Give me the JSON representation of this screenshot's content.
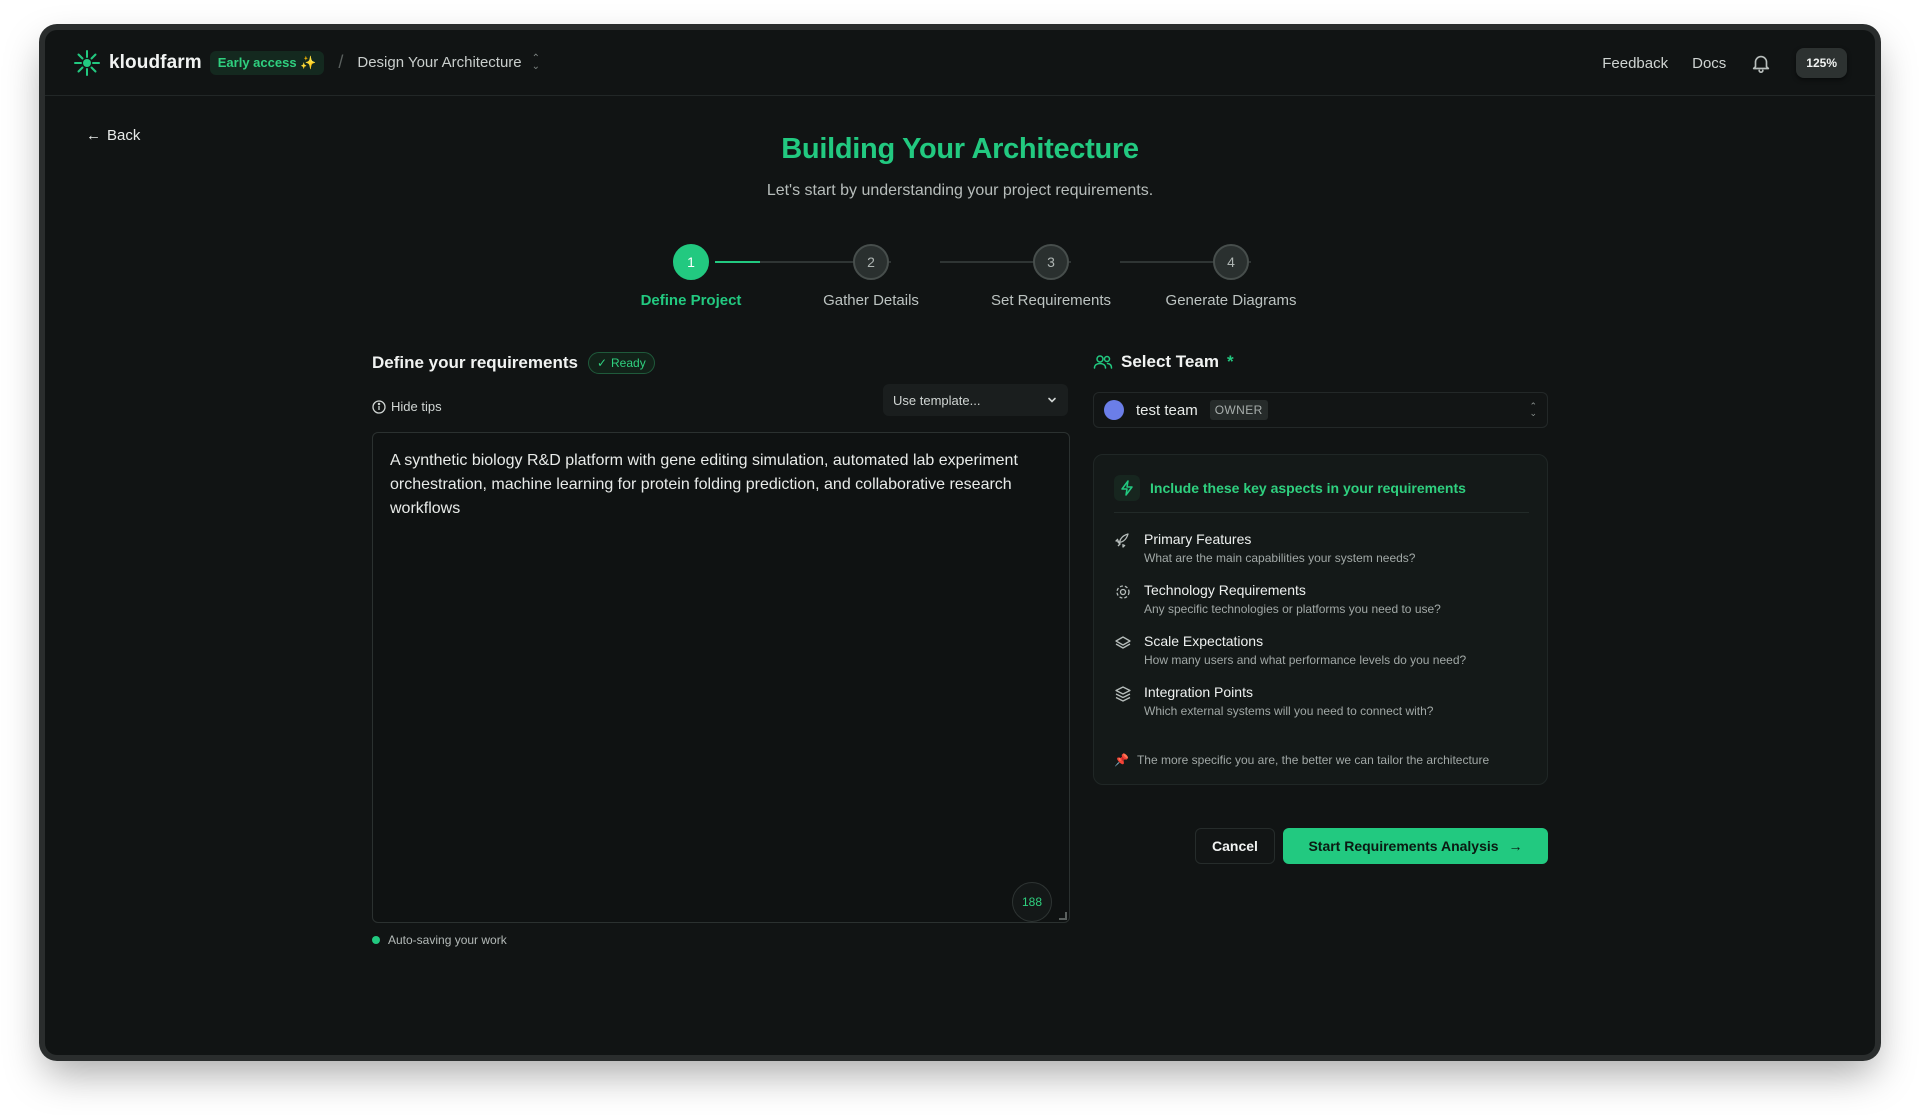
{
  "header": {
    "brand": "kloudfarm",
    "badge": "Early access ✨",
    "separator": "/",
    "breadcrumb": "Design Your Architecture",
    "links": [
      "Feedback",
      "Docs"
    ],
    "zoom": "125%"
  },
  "back_label": "Back",
  "page": {
    "title": "Building Your Architecture",
    "subtitle": "Let's start by understanding your project requirements."
  },
  "steps": [
    {
      "number": "1",
      "label": "Define Project",
      "active": true
    },
    {
      "number": "2",
      "label": "Gather Details",
      "active": false
    },
    {
      "number": "3",
      "label": "Set Requirements",
      "active": false
    },
    {
      "number": "4",
      "label": "Generate Diagrams",
      "active": false
    }
  ],
  "requirements": {
    "title": "Define your requirements",
    "status": "Ready",
    "hide_tips": "Hide tips",
    "template_label": "Use template...",
    "text": "A synthetic biology R&D platform with gene editing simulation, automated lab experiment orchestration, machine learning for protein folding prediction, and collaborative research workflows",
    "char_count": "188",
    "autosave": "Auto-saving your work"
  },
  "team": {
    "title": "Select Team",
    "required_mark": "*",
    "name": "test team",
    "role": "OWNER",
    "avatar_color": "#6b7ee8"
  },
  "tips_card": {
    "title": "Include these key aspects in your requirements",
    "items": [
      {
        "icon": "rocket-icon",
        "title": "Primary Features",
        "desc": "What are the main capabilities your system needs?"
      },
      {
        "icon": "gear-icon",
        "title": "Technology Requirements",
        "desc": "Any specific technologies or platforms you need to use?"
      },
      {
        "icon": "layers-icon",
        "title": "Scale Expectations",
        "desc": "How many users and what performance levels do you need?"
      },
      {
        "icon": "stack-icon",
        "title": "Integration Points",
        "desc": "Which external systems will you need to connect with?"
      }
    ],
    "footer": "The more specific you are, the better we can tailor the architecture"
  },
  "actions": {
    "cancel": "Cancel",
    "start": "Start Requirements Analysis"
  },
  "colors": {
    "accent": "#22c980",
    "background": "#111414"
  }
}
